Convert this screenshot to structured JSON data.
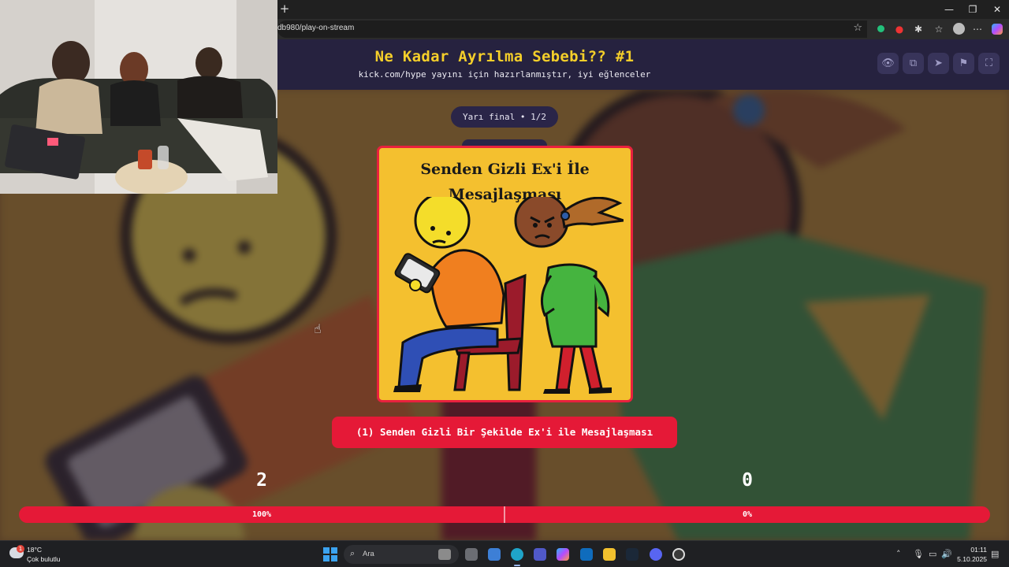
{
  "browser": {
    "new_tab": "+",
    "url": "db980/play-on-stream",
    "bookmark_icon": "star-icon",
    "window_controls": [
      "—",
      "❐",
      "✕"
    ]
  },
  "site": {
    "title": "Ne Kadar Ayrılma Sebebi?? #1",
    "subtitle": "kick.com/hype yayını için hazırlanmıştır, iyi eğlenceler",
    "header_icons": [
      "eye-icon",
      "copy-icon",
      "send-icon",
      "flag-icon",
      "fullscreen-icon"
    ]
  },
  "game": {
    "stage": "Yarı final • 1/2",
    "card": {
      "title_line1": "Senden Gizli Ex'i İle",
      "title_line2": "Mesajlaşması"
    },
    "option_label": "(1) Senden Gizli Bir Şekilde Ex'i ile Mesajlaşması",
    "score_left": "2",
    "score_right": "0",
    "pct_left": "100%",
    "pct_right": "0%",
    "vote_share_left": 1.0
  },
  "taskbar": {
    "weather_temp": "18°C",
    "weather_desc": "Çok bulutlu",
    "weather_badge": "1",
    "search_placeholder": "Ara",
    "time": "01:11",
    "date": "5.10.2025"
  },
  "colors": {
    "accent_red": "#e51937",
    "title_yellow": "#f5cf2a",
    "header_navy": "#26223f",
    "card_yellow": "#f4c02f"
  }
}
